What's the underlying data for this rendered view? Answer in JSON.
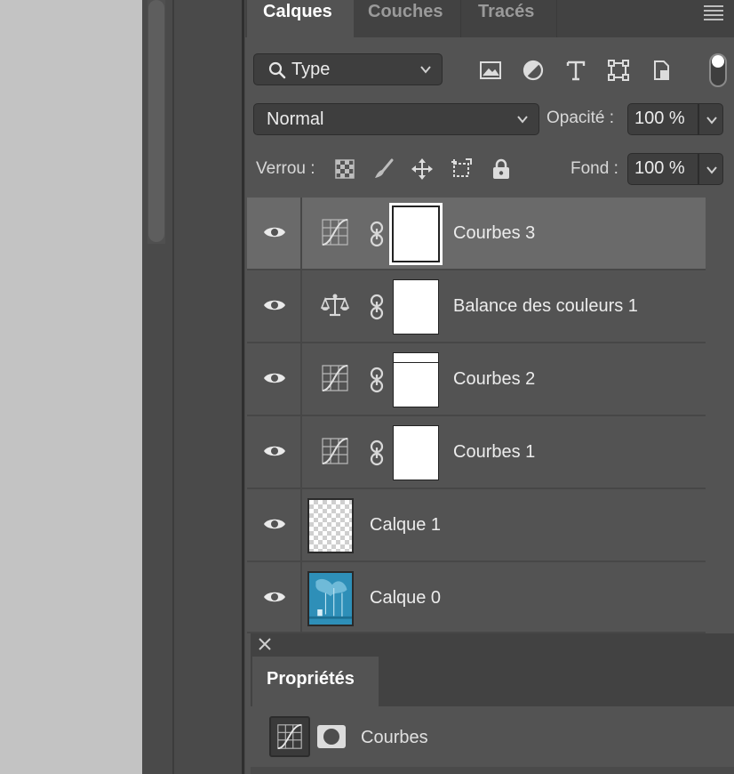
{
  "tabs": [
    {
      "label": "Calques",
      "active": true
    },
    {
      "label": "Couches",
      "active": false
    },
    {
      "label": "Tracés",
      "active": false
    }
  ],
  "filter": {
    "label": "Type"
  },
  "filter_icons": [
    "image-filter-icon",
    "adjustment-filter-icon",
    "text-filter-icon",
    "shape-filter-icon",
    "smart-object-filter-icon"
  ],
  "blend": {
    "mode": "Normal"
  },
  "opacity": {
    "label": "Opacité :",
    "value": "100 %"
  },
  "lock": {
    "label": "Verrou :"
  },
  "fill": {
    "label": "Fond :",
    "value": "100 %"
  },
  "layers": [
    {
      "name": "Courbes 3",
      "kind": "curves",
      "selected": true
    },
    {
      "name": "Balance des couleurs 1",
      "kind": "color-balance",
      "selected": false
    },
    {
      "name": "Courbes 2",
      "kind": "curves",
      "selected": false
    },
    {
      "name": "Courbes 1",
      "kind": "curves",
      "selected": false
    },
    {
      "name": "Calque 1",
      "kind": "transparent-pixel",
      "selected": false
    },
    {
      "name": "Calque 0",
      "kind": "image-pixel",
      "selected": false
    }
  ],
  "properties": {
    "tab_label": "Propriétés",
    "adjustment_name": "Courbes"
  },
  "colors": {
    "panel": "#535353",
    "selected_row": "#6a6a6a",
    "canvas": "#c3c3c3",
    "image_thumb": "#2e8fb8"
  }
}
